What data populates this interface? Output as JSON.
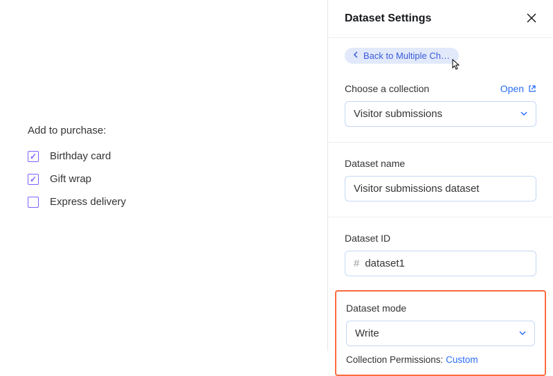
{
  "left": {
    "title": "Add to purchase:",
    "options": [
      {
        "label": "Birthday card",
        "checked": true
      },
      {
        "label": "Gift wrap",
        "checked": true
      },
      {
        "label": "Express delivery",
        "checked": false
      }
    ]
  },
  "panel": {
    "title": "Dataset Settings",
    "back_label": "Back to Multiple Choi…",
    "collection": {
      "label": "Choose a collection",
      "open_label": "Open",
      "value": "Visitor submissions"
    },
    "dataset_name": {
      "label": "Dataset name",
      "value": "Visitor submissions dataset"
    },
    "dataset_id": {
      "label": "Dataset ID",
      "prefix": "#",
      "value": "dataset1"
    },
    "dataset_mode": {
      "label": "Dataset mode",
      "value": "Write"
    },
    "permissions": {
      "label": "Collection Permissions:",
      "link": "Custom"
    }
  }
}
